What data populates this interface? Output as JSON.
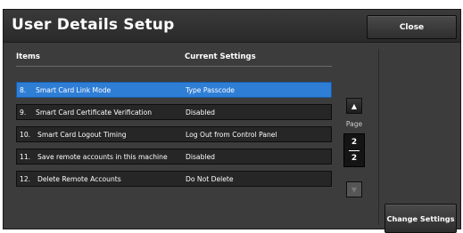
{
  "dialog": {
    "title": "User Details Setup",
    "close_label": "Close",
    "change_settings_label": "Change Settings"
  },
  "table": {
    "headers": {
      "items": "Items",
      "current": "Current Settings"
    },
    "rows": [
      {
        "num": "8.",
        "name": "Smart Card Link Mode",
        "value": "Type Passcode",
        "selected": true
      },
      {
        "num": "9.",
        "name": "Smart Card Certificate Verification",
        "value": "Disabled",
        "selected": false
      },
      {
        "num": "10.",
        "name": "Smart Card Logout Timing",
        "value": "Log Out from Control Panel",
        "selected": false
      },
      {
        "num": "11.",
        "name": "Save remote accounts in this machine",
        "value": "Disabled",
        "selected": false
      },
      {
        "num": "12.",
        "name": "Delete Remote Accounts",
        "value": "Do Not Delete",
        "selected": false
      }
    ]
  },
  "pager": {
    "label": "Page",
    "current": "2",
    "total": "2",
    "up_icon": "triangle-up-icon",
    "down_icon": "triangle-down-icon"
  },
  "colors": {
    "selected_row": "#2f7ed6",
    "background": "#3c3c3c"
  }
}
